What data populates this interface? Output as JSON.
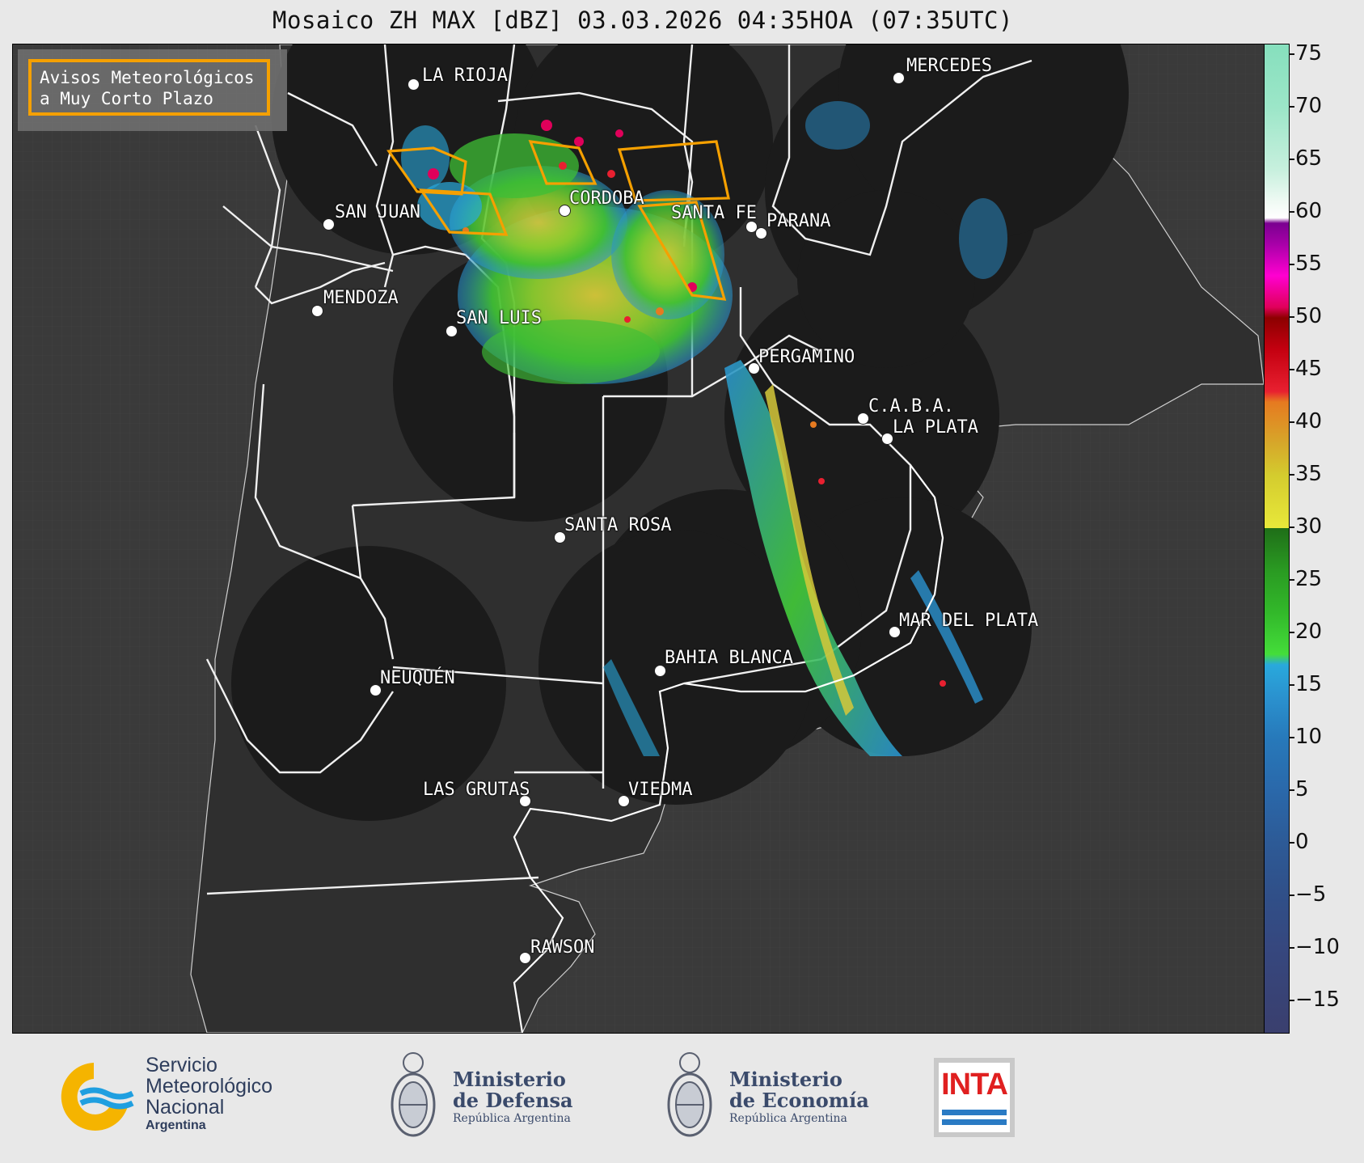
{
  "title": "Mosaico ZH MAX [dBZ] 03.03.2026 04:35HOA (07:35UTC)",
  "avisos": {
    "line1": "Avisos Meteorológicos",
    "line2": "a Muy Corto Plazo"
  },
  "cities": [
    {
      "name": "LA RIOJA",
      "id": "la-rioja"
    },
    {
      "name": "MERCEDES",
      "id": "mercedes"
    },
    {
      "name": "SAN JUAN",
      "id": "san-juan"
    },
    {
      "name": "CORDOBA",
      "id": "cordoba"
    },
    {
      "name": "SANTA FE",
      "id": "santa-fe"
    },
    {
      "name": "PARANA",
      "id": "parana"
    },
    {
      "name": "MENDOZA",
      "id": "mendoza"
    },
    {
      "name": "SAN LUIS",
      "id": "san-luis"
    },
    {
      "name": "PERGAMINO",
      "id": "pergamino"
    },
    {
      "name": "C.A.B.A.",
      "id": "caba"
    },
    {
      "name": "LA PLATA",
      "id": "la-plata"
    },
    {
      "name": "SANTA ROSA",
      "id": "santa-rosa"
    },
    {
      "name": "MAR DEL PLATA",
      "id": "mar-del-plata"
    },
    {
      "name": "BAHIA BLANCA",
      "id": "bahia-blanca"
    },
    {
      "name": "NEUQUÉN",
      "id": "neuquen"
    },
    {
      "name": "LAS GRUTAS",
      "id": "las-grutas"
    },
    {
      "name": "VIEDMA",
      "id": "viedma"
    },
    {
      "name": "RAWSON",
      "id": "rawson"
    }
  ],
  "colorbar": {
    "ticks": [
      "75",
      "70",
      "65",
      "60",
      "55",
      "50",
      "45",
      "40",
      "35",
      "30",
      "25",
      "20",
      "15",
      "10",
      "5",
      "0",
      "−5",
      "−10",
      "−15"
    ],
    "range": [
      -18,
      76
    ],
    "stops": [
      {
        "v": -18,
        "c": "#3a3f6e"
      },
      {
        "v": -10,
        "c": "#36477e"
      },
      {
        "v": -5,
        "c": "#304f88"
      },
      {
        "v": 0,
        "c": "#2d5a96"
      },
      {
        "v": 5,
        "c": "#2a68aa"
      },
      {
        "v": 10,
        "c": "#2779ba"
      },
      {
        "v": 14,
        "c": "#2a92cf"
      },
      {
        "v": 17,
        "c": "#29a9dc"
      },
      {
        "v": 18,
        "c": "#44dd3a"
      },
      {
        "v": 22,
        "c": "#32b82a"
      },
      {
        "v": 26,
        "c": "#2a9a22"
      },
      {
        "v": 30,
        "c": "#1f6e18"
      },
      {
        "v": 30.01,
        "c": "#e8e83a"
      },
      {
        "v": 35,
        "c": "#d4cc2e"
      },
      {
        "v": 38,
        "c": "#d6a82a"
      },
      {
        "v": 42,
        "c": "#e67a20"
      },
      {
        "v": 43,
        "c": "#e82030"
      },
      {
        "v": 47,
        "c": "#c40010"
      },
      {
        "v": 50,
        "c": "#8c0000"
      },
      {
        "v": 51,
        "c": "#e0005a"
      },
      {
        "v": 54,
        "c": "#ff00d0"
      },
      {
        "v": 57,
        "c": "#a800a8"
      },
      {
        "v": 59,
        "c": "#7a0090"
      },
      {
        "v": 59.5,
        "c": "#ffffff"
      },
      {
        "v": 61,
        "c": "#f0faf4"
      },
      {
        "v": 64,
        "c": "#c8f0de"
      },
      {
        "v": 70,
        "c": "#9ce6c8"
      },
      {
        "v": 76,
        "c": "#86dfbd"
      }
    ]
  },
  "footer": {
    "smn": {
      "line1": "Servicio",
      "line2": "Meteorológico",
      "line3": "Nacional",
      "line4": "Argentina"
    },
    "defensa": {
      "line1": "Ministerio",
      "line2": "de Defensa",
      "line3": "República Argentina"
    },
    "economia": {
      "line1": "Ministerio",
      "line2": "de Economía",
      "line3": "República Argentina"
    },
    "inta": {
      "label": "INTA"
    }
  },
  "colors": {
    "warning": "#f5a000",
    "land_dark": "#1c1c1c",
    "background": "#3a3a3a"
  }
}
